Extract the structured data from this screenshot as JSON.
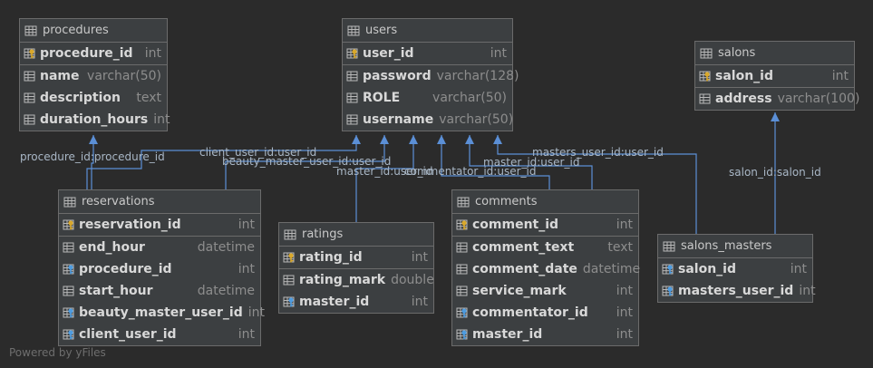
{
  "tables": {
    "procedures": {
      "title": "procedures",
      "columns": [
        {
          "name": "procedure_id",
          "type": "int",
          "kind": "pk"
        },
        {
          "name": "name",
          "type": "varchar(50)",
          "kind": "col"
        },
        {
          "name": "description",
          "type": "text",
          "kind": "col"
        },
        {
          "name": "duration_hours",
          "type": "int",
          "kind": "col"
        }
      ]
    },
    "users": {
      "title": "users",
      "columns": [
        {
          "name": "user_id",
          "type": "int",
          "kind": "pk"
        },
        {
          "name": "password",
          "type": "varchar(128)",
          "kind": "col"
        },
        {
          "name": "ROLE",
          "type": "varchar(50)",
          "kind": "col"
        },
        {
          "name": "username",
          "type": "varchar(50)",
          "kind": "col"
        }
      ]
    },
    "salons": {
      "title": "salons",
      "columns": [
        {
          "name": "salon_id",
          "type": "int",
          "kind": "pk"
        },
        {
          "name": "address",
          "type": "varchar(100)",
          "kind": "col"
        }
      ]
    },
    "reservations": {
      "title": "reservations",
      "columns": [
        {
          "name": "reservation_id",
          "type": "int",
          "kind": "pk"
        },
        {
          "name": "end_hour",
          "type": "datetime",
          "kind": "col"
        },
        {
          "name": "procedure_id",
          "type": "int",
          "kind": "fk"
        },
        {
          "name": "start_hour",
          "type": "datetime",
          "kind": "col"
        },
        {
          "name": "beauty_master_user_id",
          "type": "int",
          "kind": "fk"
        },
        {
          "name": "client_user_id",
          "type": "int",
          "kind": "fk"
        }
      ]
    },
    "ratings": {
      "title": "ratings",
      "columns": [
        {
          "name": "rating_id",
          "type": "int",
          "kind": "pk"
        },
        {
          "name": "rating_mark",
          "type": "double",
          "kind": "col"
        },
        {
          "name": "master_id",
          "type": "int",
          "kind": "fk"
        }
      ]
    },
    "comments": {
      "title": "comments",
      "columns": [
        {
          "name": "comment_id",
          "type": "int",
          "kind": "pk"
        },
        {
          "name": "comment_text",
          "type": "text",
          "kind": "col"
        },
        {
          "name": "comment_date",
          "type": "datetime",
          "kind": "col"
        },
        {
          "name": "service_mark",
          "type": "int",
          "kind": "col"
        },
        {
          "name": "commentator_id",
          "type": "int",
          "kind": "fk"
        },
        {
          "name": "master_id",
          "type": "int",
          "kind": "fk"
        }
      ]
    },
    "salons_masters": {
      "title": "salons_masters",
      "columns": [
        {
          "name": "salon_id",
          "type": "int",
          "kind": "fk"
        },
        {
          "name": "masters_user_id",
          "type": "int",
          "kind": "fk"
        }
      ]
    }
  },
  "relations": [
    {
      "id": "rel-procedure",
      "label": "procedure_id:procedure_id"
    },
    {
      "id": "rel-client",
      "label": "client_user_id:user_id"
    },
    {
      "id": "rel-beauty-master",
      "label": "beauty_master_user_id:user_id"
    },
    {
      "id": "rel-rating-master",
      "label": "master_id:user_id"
    },
    {
      "id": "rel-commentator",
      "label": "commentator_id:user_id"
    },
    {
      "id": "rel-comment-master",
      "label": "master_id:user_id"
    },
    {
      "id": "rel-salon-masters",
      "label": "masters_user_id:user_id"
    },
    {
      "id": "rel-salon",
      "label": "salon_id:salon_id"
    }
  ],
  "footer": "Powered by yFiles",
  "colors": {
    "background": "#2b2b2b",
    "table_fill": "#3c3f41",
    "border": "#6b6b6b",
    "link": "#5b8fd6",
    "label": "#a9b7c6",
    "key_gold": "#d9a82b",
    "key_blue": "#4e9ce0"
  }
}
